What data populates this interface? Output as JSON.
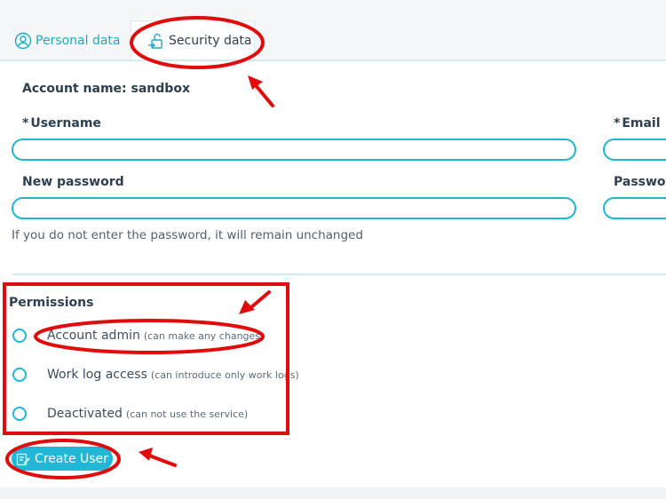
{
  "tabs": [
    {
      "label": "Personal data",
      "icon": "user-circle-icon"
    },
    {
      "label": "Security data",
      "icon": "unlock-icon"
    }
  ],
  "account": {
    "prefix": "Account name:",
    "value": "sandbox"
  },
  "form": {
    "username_label": "Username",
    "email_label": "Email",
    "new_password_label": "New password",
    "password_repeat_label": "Passwor",
    "required_mark": "*",
    "password_hint": "If you do not enter the password, it will remain unchanged"
  },
  "permissions": {
    "title": "Permissions",
    "options": [
      {
        "label": "Account admin",
        "detail": "(can make any changes)"
      },
      {
        "label": "Work log access",
        "detail": "(can introduce only work logs)"
      },
      {
        "label": "Deactivated",
        "detail": "(can not use the service)"
      }
    ]
  },
  "actions": {
    "create_label": "Create User",
    "create_icon": "edit-icon"
  },
  "colors": {
    "accent": "#1fb6d2",
    "annotation": "#e20b0b",
    "text": "#2e3f52"
  }
}
